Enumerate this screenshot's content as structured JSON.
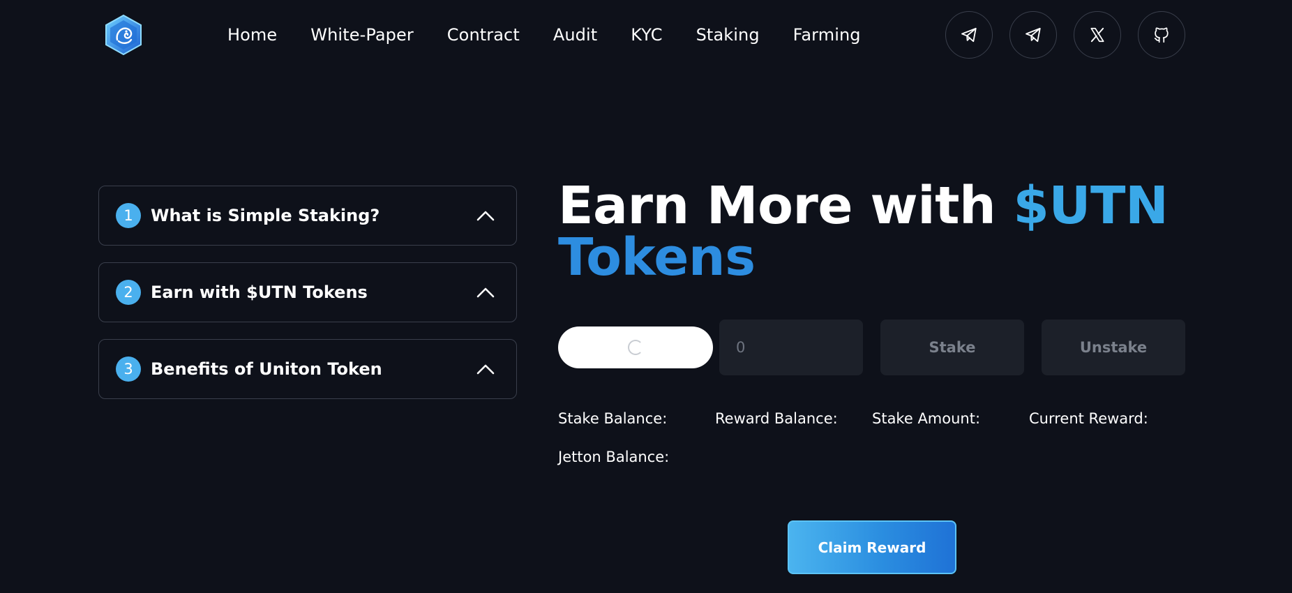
{
  "header": {
    "logo_icon": "uniton-dragon-hexagon-logo",
    "nav": [
      "Home",
      "White-Paper",
      "Contract",
      "Audit",
      "KYC",
      "Staking",
      "Farming"
    ],
    "socials": [
      {
        "icon": "telegram-icon"
      },
      {
        "icon": "telegram-icon"
      },
      {
        "icon": "x-twitter-icon"
      },
      {
        "icon": "github-icon"
      }
    ]
  },
  "accordion": [
    {
      "number": "1",
      "title": "What is Simple Staking?"
    },
    {
      "number": "2",
      "title": "Earn with $UTN Tokens"
    },
    {
      "number": "3",
      "title": "Benefits of Uniton Token"
    }
  ],
  "hero": {
    "line1_prefix": "Earn More with ",
    "line1_accent": "$UTN",
    "line2_accent": "Tokens"
  },
  "controls": {
    "amount_placeholder": "0",
    "stake_label": "Stake",
    "unstake_label": "Unstake"
  },
  "stats": {
    "stake_balance_label": "Stake Balance:",
    "reward_balance_label": "Reward Balance:",
    "stake_amount_label": "Stake Amount:",
    "current_reward_label": "Current Reward:",
    "jetton_balance_label": "Jetton Balance:"
  },
  "claim_label": "Claim Reward",
  "colors": {
    "background": "#0e111a",
    "accent_light": "#3aa8e8",
    "accent_dark": "#2d8de0",
    "panel": "#1c2029",
    "border": "#3a3f4c"
  }
}
